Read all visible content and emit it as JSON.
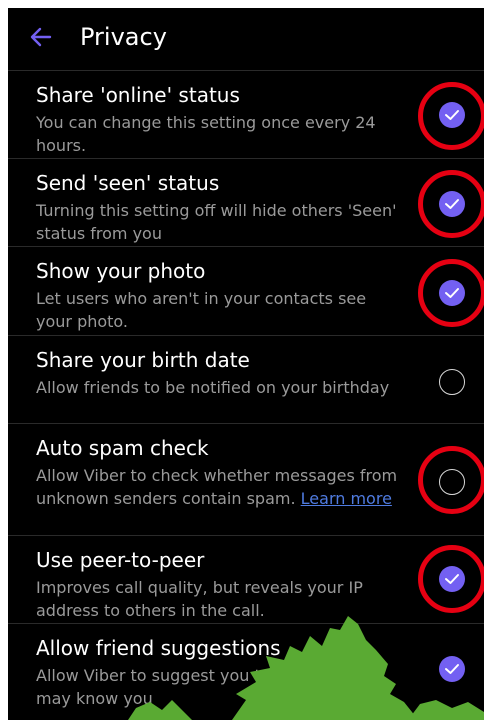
{
  "header": {
    "title": "Privacy",
    "back_icon": "back-arrow-icon",
    "accent_color": "#7360f2"
  },
  "settings": [
    {
      "title": "Share 'online' status",
      "description": "You can change this setting once every 24 hours.",
      "checked": true
    },
    {
      "title": "Send 'seen' status",
      "description": "Turning this setting off will hide others 'Seen' status from you",
      "checked": true
    },
    {
      "title": "Show your photo",
      "description": "Let users who aren't in your contacts see your photo.",
      "checked": true
    },
    {
      "title": "Share your birth date",
      "description": "Allow friends to be notified on your birthday",
      "checked": false
    },
    {
      "title": "Auto spam check",
      "description": "Allow Viber to check whether messages from unknown senders contain spam.",
      "link_text": "Learn more",
      "checked": false
    },
    {
      "title": "Use peer-to-peer",
      "description": "Improves call quality, but reveals your IP address to others in the call.",
      "checked": true
    },
    {
      "title": "Allow friend suggestions",
      "description": "Allow Viber to suggest you to people who may know you",
      "checked": true
    }
  ],
  "annotation_color": "#e60012"
}
